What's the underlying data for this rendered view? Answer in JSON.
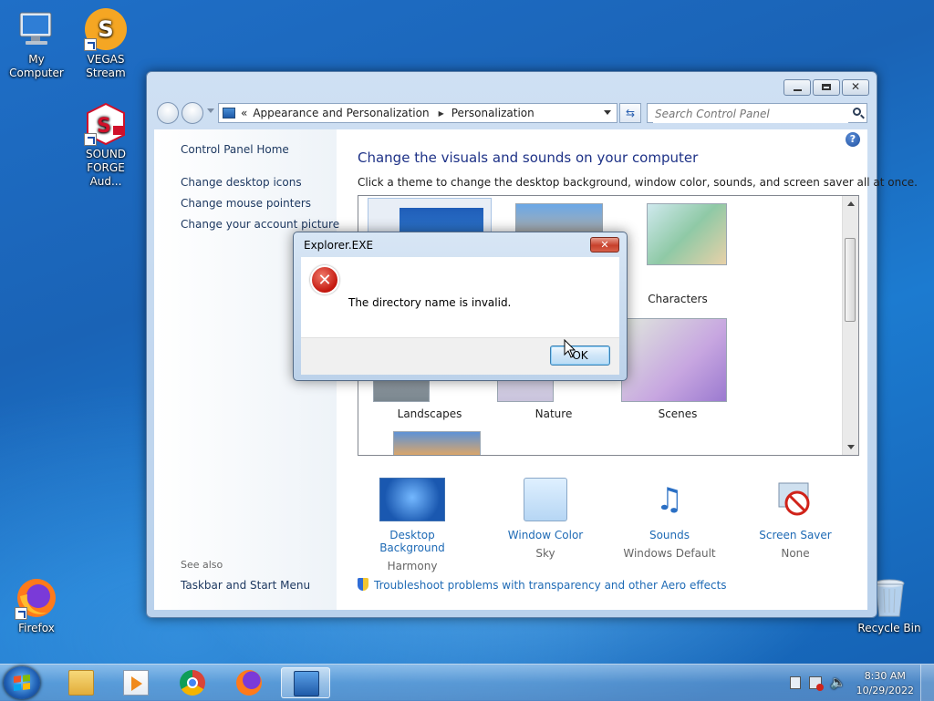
{
  "desktop": {
    "icons": [
      {
        "label": "My Computer"
      },
      {
        "label": "VEGAS Stream"
      },
      {
        "label": "SOUND FORGE Aud..."
      },
      {
        "label": "Firefox"
      },
      {
        "label": "Recycle Bin"
      }
    ]
  },
  "window": {
    "address": {
      "back_label": "«",
      "crumbs": [
        "Appearance and Personalization",
        "Personalization"
      ]
    },
    "search": {
      "placeholder": "Search Control Panel"
    },
    "sidebar": {
      "home": "Control Panel Home",
      "links": [
        "Change desktop icons",
        "Change mouse pointers",
        "Change your account picture"
      ],
      "see_also": "See also",
      "see_also_links": [
        "Taskbar and Start Menu"
      ]
    },
    "main": {
      "title": "Change the visuals and sounds on your computer",
      "subtitle": "Click a theme to change the desktop background, window color, sounds, and screen saver all at once.",
      "themes": [
        "Characters",
        "Landscapes",
        "Nature",
        "Scenes"
      ],
      "settings": [
        {
          "label": "Desktop Background",
          "value": "Harmony"
        },
        {
          "label": "Window Color",
          "value": "Sky"
        },
        {
          "label": "Sounds",
          "value": "Windows Default"
        },
        {
          "label": "Screen Saver",
          "value": "None"
        }
      ],
      "troubleshoot": "Troubleshoot problems with transparency and other Aero effects"
    }
  },
  "dialog": {
    "title": "Explorer.EXE",
    "message": "The directory name is invalid.",
    "ok_label": "OK"
  },
  "taskbar": {
    "time": "8:30 AM",
    "date": "10/29/2022"
  },
  "colors": {
    "link": "#1e6ab5",
    "title": "#1e3287",
    "error": "#c3160d"
  }
}
